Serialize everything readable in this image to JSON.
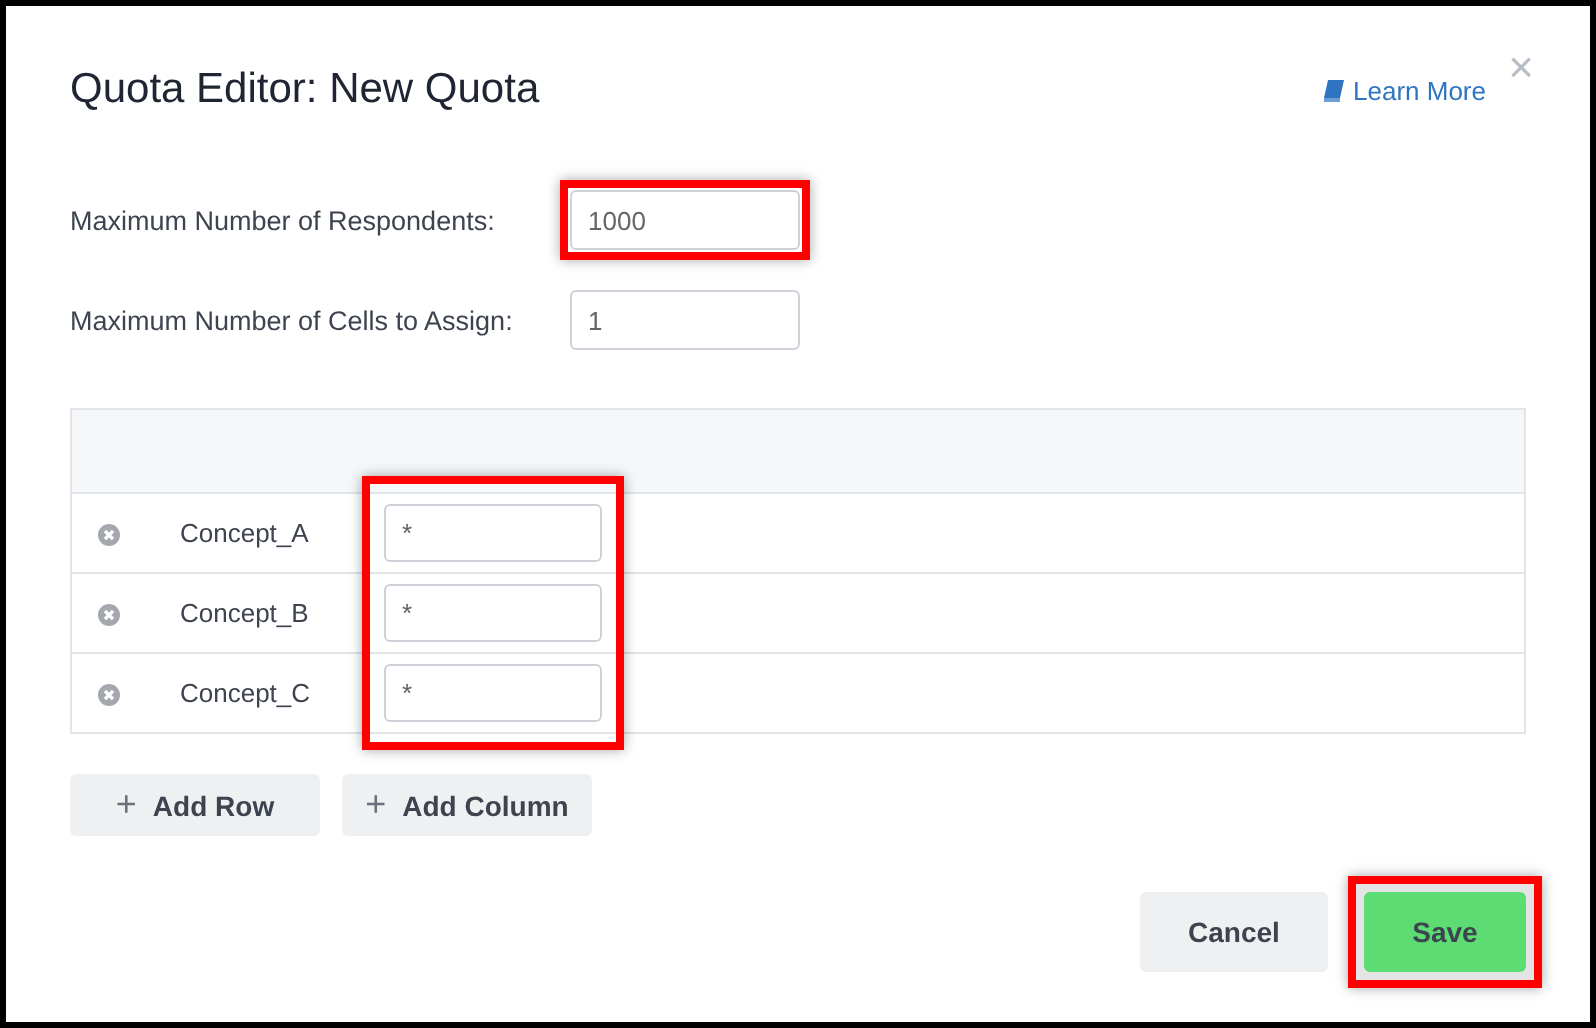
{
  "dialog": {
    "title": "Quota Editor: New Quota",
    "help_link": "Learn More",
    "close": "×"
  },
  "fields": [
    {
      "label": "Maximum Number of Respondents:",
      "value": "1000",
      "highlighted": true
    },
    {
      "label": "Maximum Number of Cells to Assign:",
      "value": "1",
      "highlighted": false
    }
  ],
  "table": {
    "value_column_highlighted": true,
    "rows": [
      {
        "name": "Concept_A",
        "value": "*"
      },
      {
        "name": "Concept_B",
        "value": "*"
      },
      {
        "name": "Concept_C",
        "value": "*"
      }
    ]
  },
  "table_buttons": [
    {
      "icon": "+",
      "label": "Add Row"
    },
    {
      "icon": "+",
      "label": "Add Column"
    }
  ],
  "footer_buttons": [
    {
      "kind": "secondary",
      "label": "Cancel",
      "highlighted": false
    },
    {
      "kind": "primary",
      "label": "Save",
      "highlighted": true
    }
  ]
}
